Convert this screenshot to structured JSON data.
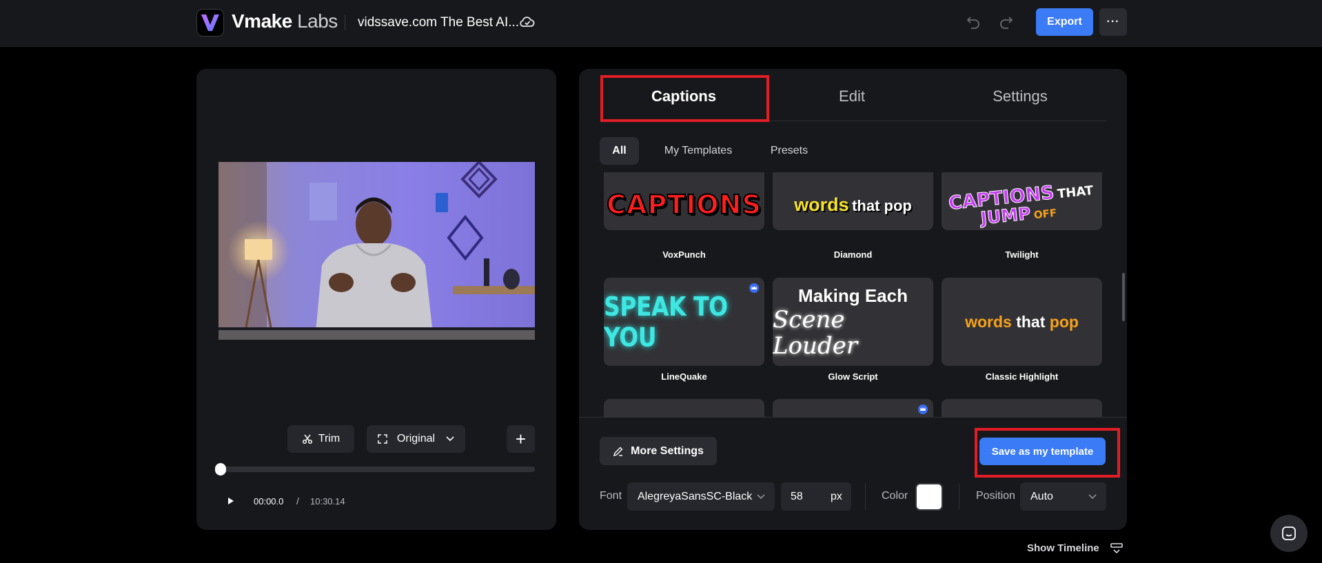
{
  "header": {
    "brand_name": "Vmake",
    "brand_suffix": "Labs",
    "project_title": "vidssave.com The Best AI...",
    "export_label": "Export",
    "more_label": "···"
  },
  "preview": {
    "trim_label": "Trim",
    "ratio_label": "Original",
    "add_label": "+",
    "current_time": "00:00.0",
    "separator": "/",
    "total_time": "10:30.14",
    "progress_fraction": 0
  },
  "tabs": [
    {
      "label": "Captions",
      "active": true
    },
    {
      "label": "Edit",
      "active": false
    },
    {
      "label": "Settings",
      "active": false
    }
  ],
  "filters": [
    {
      "label": "All",
      "active": true
    },
    {
      "label": "My Templates",
      "active": false
    },
    {
      "label": "Presets",
      "active": false
    }
  ],
  "templates": [
    {
      "name": "VoxPunch",
      "preview_text": "CAPTIONS"
    },
    {
      "name": "Diamond",
      "preview_text_1": "words",
      "preview_text_2": "that pop"
    },
    {
      "name": "Twilight",
      "preview_text_1": "CAPTIONS",
      "preview_text_2": "THAT",
      "preview_text_3": "JUMP",
      "preview_text_4": "OFF"
    },
    {
      "name": "LineQuake",
      "preview_text": "SPEAK TO YOU",
      "premium": true
    },
    {
      "name": "Glow Script",
      "preview_text_1": "Making Each",
      "preview_text_2": "Scene Louder"
    },
    {
      "name": "Classic Highlight",
      "preview_text_1": "words",
      "preview_text_2": "that",
      "preview_text_3": "pop"
    }
  ],
  "bottom": {
    "more_settings_label": "More Settings",
    "save_template_label": "Save as my template",
    "font_label": "Font",
    "font_value": "AlegreyaSansSC-Black",
    "size_value": "58",
    "size_unit": "px",
    "color_label": "Color",
    "color_value": "#ffffff",
    "position_label": "Position",
    "position_value": "Auto"
  },
  "footer": {
    "show_timeline_label": "Show Timeline"
  },
  "colors": {
    "accent": "#3b7bf6",
    "highlight_box": "#e21d25",
    "panel_bg": "#17181c"
  }
}
